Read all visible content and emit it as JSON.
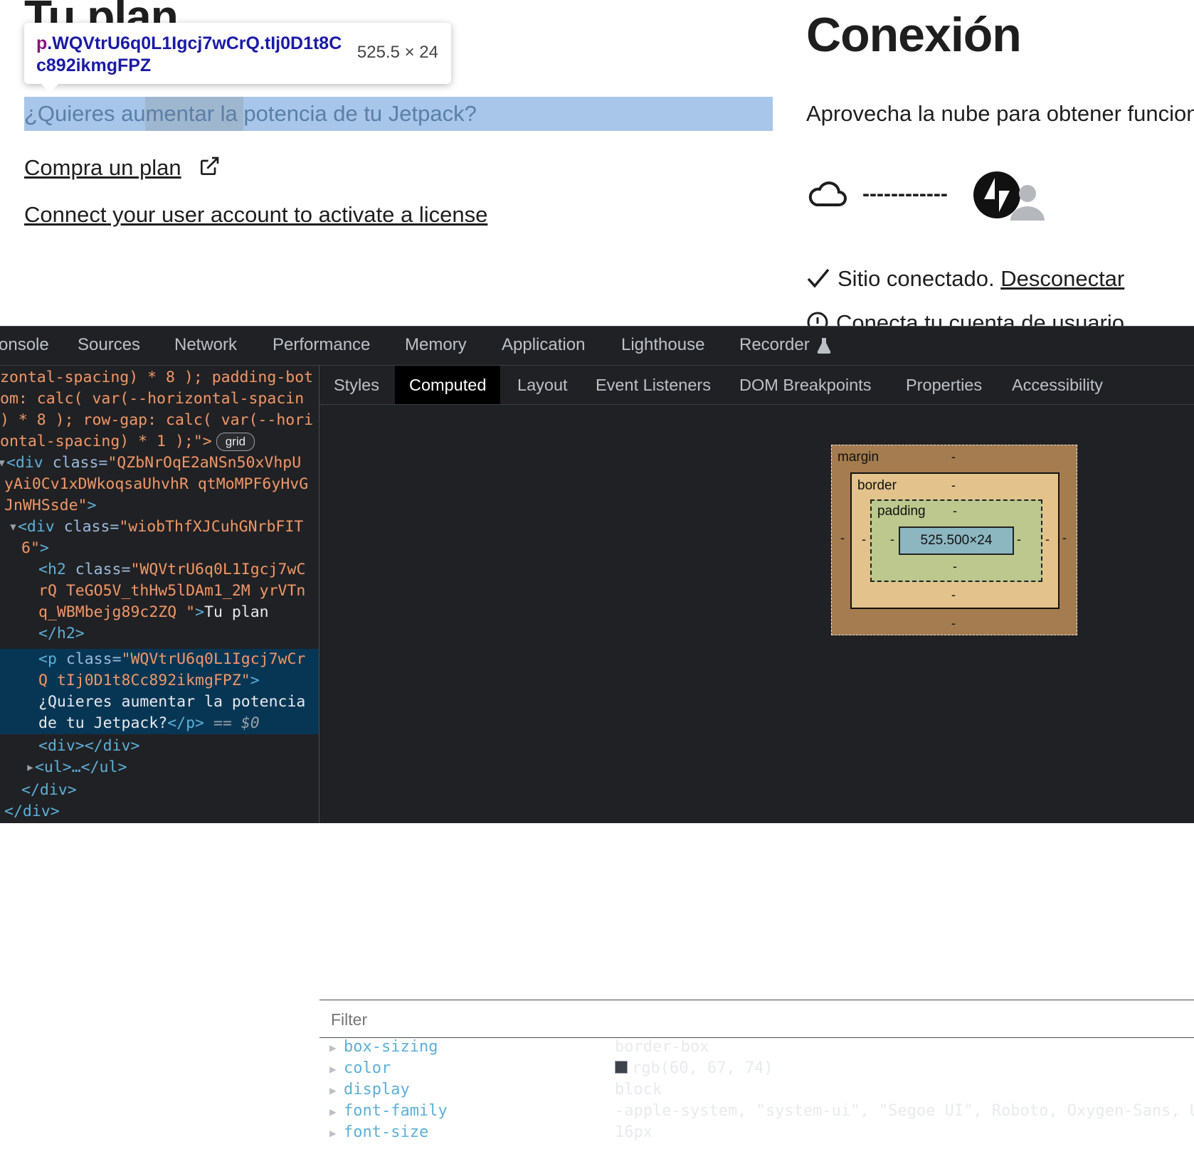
{
  "page": {
    "hidden_title": "Tu plan",
    "tooltip": {
      "tag": "p",
      "selector": ".WQVtrU6q0L1Igcj7wCrQ.tIj0D1t8Cc892ikmgFPZ",
      "size": "525.5 × 24"
    },
    "highlighted_paragraph": "¿Quieres aumentar la potencia de tu Jetpack?",
    "buy_plan_link": "Compra un plan",
    "connect_account_link": "Connect your user account to activate a license",
    "connection": {
      "title": "Conexión",
      "description": "Aprovecha la nube para obtener funciones",
      "dashes": "------------",
      "site_connected": "Sitio conectado.",
      "disconnect_link": "Desconectar",
      "connect_user": "Conecta tu cuenta de usuario"
    }
  },
  "devtools": {
    "tabs": [
      "onsole",
      "Sources",
      "Network",
      "Performance",
      "Memory",
      "Application",
      "Lighthouse",
      "Recorder"
    ],
    "elements": {
      "line1": "zontal-spacing) * 8 ); padding-bot",
      "line2": "om: calc( var(--horizontal-spacin",
      "line3": ") * 8 ); row-gap: calc( var(--hori",
      "line4": "ontal-spacing) * 1 );\">",
      "grid_badge": "grid",
      "div1_open": "<div ",
      "div1_attr": "class=",
      "div1_val_a": "\"QZbNrOqE2aNSn50xVhpU",
      "div1_val_b": "yAi0Cv1xDWkoqsaUhvhR qtMoMPF6yHvG",
      "div1_val_c": "JnWHSsde\"",
      "div1_close": ">",
      "div2_open": "<div ",
      "div2_attr": "class=",
      "div2_val_a": "\"wiobThfXJCuhGNrbFIT",
      "div2_val_b": "6\"",
      "div2_close": ">",
      "h2_open": "<h2 ",
      "h2_attr": "class=",
      "h2_val_a": "\"WQVtrU6q0L1Igcj7wC",
      "h2_val_b": "rQ TeGO5V_thHw5lDAm1_2M yrVTn",
      "h2_val_c": "q_WBMbejg89c2ZQ \"",
      "h2_gt": ">",
      "h2_text": "Tu plan",
      "h2_end": "</h2>",
      "p_open": "<p ",
      "p_attr": "class=",
      "p_val_a": "\"WQVtrU6q0L1Igcj7wCr",
      "p_val_b": "Q tIj0D1t8Cc892ikmgFPZ\"",
      "p_gt": ">",
      "p_text_a": "¿Quieres aumentar la potencia",
      "p_text_b": "de tu Jetpack?",
      "p_end": "</p>",
      "p_eq": " == ",
      "p_ref": "$0",
      "empty_div": "<div></div>",
      "ul": "<ul>…</ul>",
      "div_end1": "</div>",
      "div_end2": "</div>"
    },
    "subtabs": [
      "Styles",
      "Computed",
      "Layout",
      "Event Listeners",
      "DOM Breakpoints",
      "Properties",
      "Accessibility"
    ],
    "active_subtab": "Computed",
    "box_model": {
      "margin_label": "margin",
      "border_label": "border",
      "padding_label": "padding",
      "content": "525.500×24",
      "dash": "-"
    },
    "filter_placeholder": "Filter",
    "properties": [
      {
        "name": "box-sizing",
        "value": "border-box"
      },
      {
        "name": "color",
        "value": "rgb(60, 67, 74)",
        "swatch": "#3c434a"
      },
      {
        "name": "display",
        "value": "block"
      },
      {
        "name": "font-family",
        "value": "-apple-system, \"system-ui\", \"Segoe UI\", Roboto, Oxygen-Sans, U"
      },
      {
        "name": "font-size",
        "value": "16px"
      }
    ]
  }
}
